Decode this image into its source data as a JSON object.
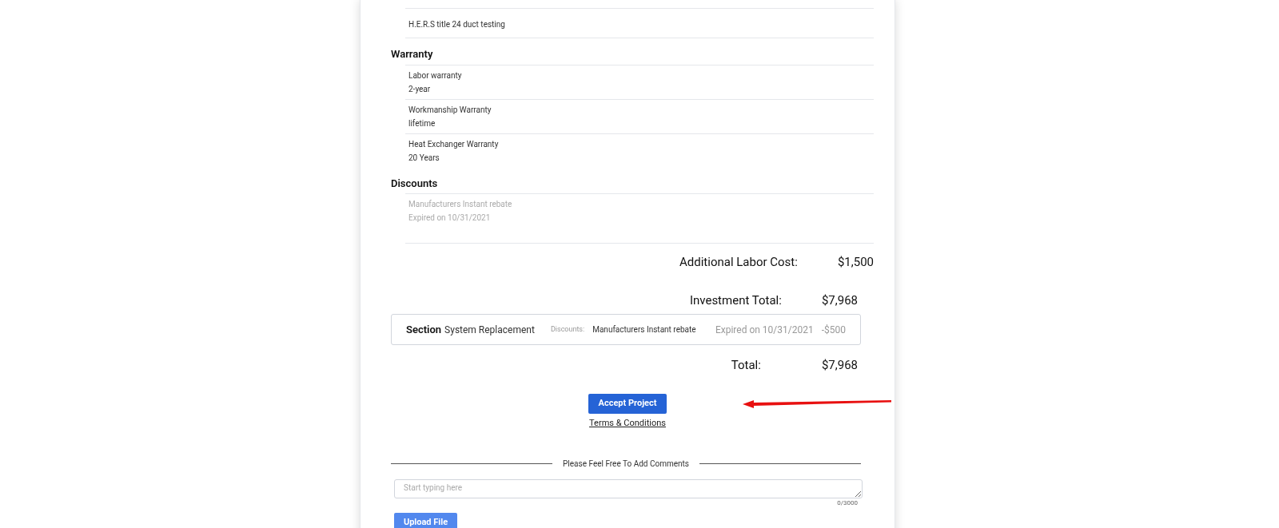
{
  "top_items": [
    {
      "label": "H.E.R.S title 24 duct testing"
    }
  ],
  "sections": [
    {
      "title": "Warranty",
      "items": [
        {
          "label": "Labor warranty",
          "value": "2-year",
          "expired": false
        },
        {
          "label": "Workmanship Warranty",
          "value": "lifetime",
          "expired": false
        },
        {
          "label": "Heat Exchanger Warranty",
          "value": "20 Years",
          "expired": false
        }
      ]
    },
    {
      "title": "Discounts",
      "items": [
        {
          "label": "Manufacturers Instant rebate",
          "value": "Expired on 10/31/2021",
          "expired": true
        }
      ]
    }
  ],
  "additional_labor": {
    "label": "Additional Labor Cost:",
    "value": "$1,500"
  },
  "investment_total": {
    "label": "Investment Total:",
    "value": "$7,968"
  },
  "section_summary": {
    "heading": "Section",
    "name": "System Replacement",
    "discounts_label": "Discounts:",
    "discount_name": "Manufacturers Instant rebate",
    "expiry": "Expired on 10/31/2021",
    "amount": "-$500"
  },
  "total": {
    "label": "Total:",
    "value": "$7,968"
  },
  "accept_button": "Accept Project",
  "terms_link": "Terms & Conditions",
  "comments": {
    "heading": "Please Feel Free To Add Comments",
    "placeholder": "Start typing here",
    "counter": "0/3000"
  },
  "upload_button": "Upload File"
}
